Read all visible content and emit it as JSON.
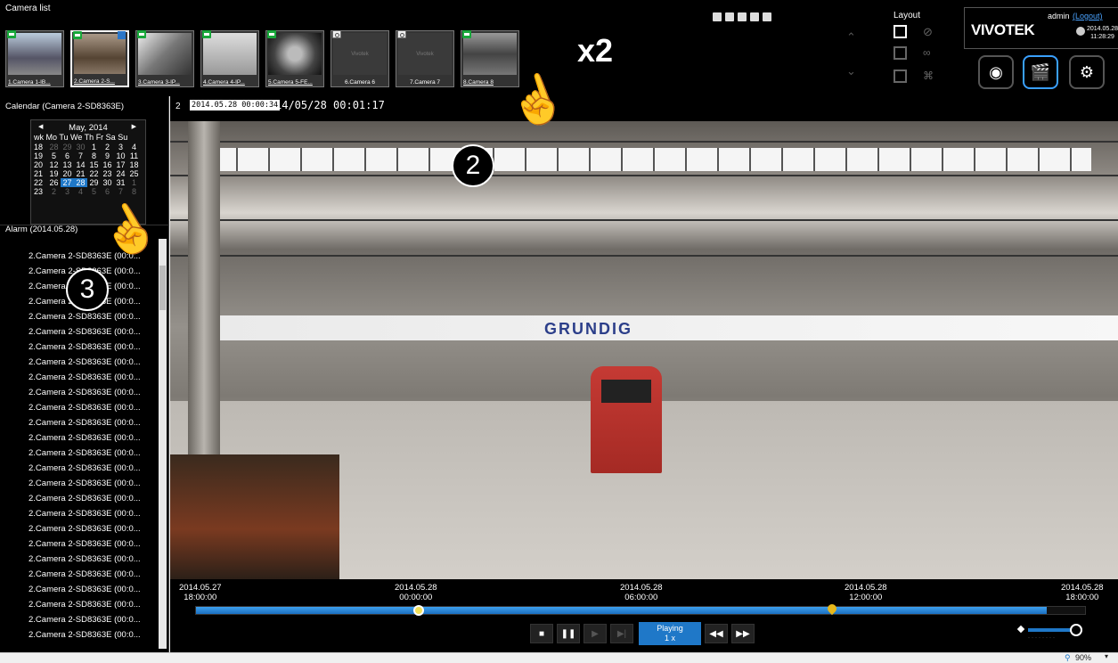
{
  "camera_list": {
    "title": "Camera list",
    "cameras": [
      {
        "label": "1.Camera 1-IB...",
        "status": "recording",
        "has_signal": true,
        "ptz": false,
        "selected": false
      },
      {
        "label": "2.Camera 2-S...",
        "status": "recording",
        "has_signal": true,
        "ptz": true,
        "selected": true
      },
      {
        "label": "3.Camera 3-IP...",
        "status": "recording",
        "has_signal": true,
        "ptz": false,
        "selected": false
      },
      {
        "label": "4.Camera 4-IP...",
        "status": "recording",
        "has_signal": true,
        "ptz": false,
        "selected": false
      },
      {
        "label": "5.Camera 5-FE...",
        "status": "recording",
        "has_signal": true,
        "ptz": false,
        "selected": false
      },
      {
        "label": "6.Camera 6",
        "status": "offline",
        "has_signal": false,
        "ptz": false,
        "selected": false
      },
      {
        "label": "7.Camera 7",
        "status": "offline",
        "has_signal": false,
        "ptz": false,
        "selected": false
      },
      {
        "label": "8.Camera 8",
        "status": "recording",
        "has_signal": true,
        "ptz": false,
        "selected": false
      }
    ],
    "no_signal_text": "Vivotek"
  },
  "overlay": {
    "double_click": "x2",
    "step_video": "2",
    "step_alarm": "3"
  },
  "layout": {
    "title": "Layout"
  },
  "brand": {
    "logo": "VIVOTEK",
    "user": "admin",
    "logout": "(Logout)",
    "date": "2014.05.28",
    "time": "11:28:29"
  },
  "calendar": {
    "title": "Calendar (Camera 2-SD8363E)",
    "month": "May, 2014",
    "header": "wk Mo Tu We Th Fr  Sa Su",
    "weeks": [
      {
        "wk": "18",
        "days": [
          "28",
          "29",
          "30",
          "1",
          "2",
          "3",
          "4"
        ],
        "dim": [
          0,
          1,
          2
        ]
      },
      {
        "wk": "19",
        "days": [
          "5",
          "6",
          "7",
          "8",
          "9",
          "10",
          "11"
        ],
        "dim": []
      },
      {
        "wk": "20",
        "days": [
          "12",
          "13",
          "14",
          "15",
          "16",
          "17",
          "18"
        ],
        "dim": []
      },
      {
        "wk": "21",
        "days": [
          "19",
          "20",
          "21",
          "22",
          "23",
          "24",
          "25"
        ],
        "dim": []
      },
      {
        "wk": "22",
        "days": [
          "26",
          "27",
          "28",
          "29",
          "30",
          "31",
          "1"
        ],
        "dim": [
          6
        ],
        "selected": [
          1,
          2
        ]
      },
      {
        "wk": "23",
        "days": [
          "2",
          "3",
          "4",
          "5",
          "6",
          "7",
          "8"
        ],
        "dim": [
          0,
          1,
          2,
          3,
          4,
          5,
          6
        ]
      }
    ]
  },
  "alarm": {
    "title": "Alarm (2014.05.28)",
    "items": [
      "2.Camera 2-SD8363E (00:0...",
      "2.Camera 2-SD8363E (00:0...",
      "2.Camera 2-SD8363E (00:0...",
      "2.Camera 2-SD8363E (00:0...",
      "2.Camera 2-SD8363E (00:0...",
      "2.Camera 2-SD8363E (00:0...",
      "2.Camera 2-SD8363E (00:0...",
      "2.Camera 2-SD8363E (00:0...",
      "2.Camera 2-SD8363E (00:0...",
      "2.Camera 2-SD8363E (00:0...",
      "2.Camera 2-SD8363E (00:0...",
      "2.Camera 2-SD8363E (00:0...",
      "2.Camera 2-SD8363E (00:0...",
      "2.Camera 2-SD8363E (00:0...",
      "2.Camera 2-SD8363E (00:0...",
      "2.Camera 2-SD8363E (00:0...",
      "2.Camera 2-SD8363E (00:0...",
      "2.Camera 2-SD8363E (00:0...",
      "2.Camera 2-SD8363E (00:0...",
      "2.Camera 2-SD8363E (00:0...",
      "2.Camera 2-SD8363E (00:0...",
      "2.Camera 2-SD8363E (00:0...",
      "2.Camera 2-SD8363E (00:0...",
      "2.Camera 2-SD8363E (00:0...",
      "2.Camera 2-SD8363E (00:0...",
      "2.Camera 2-SD8363E (00:0..."
    ]
  },
  "video": {
    "channel": "2",
    "start_stamp": "2014.05.28 00:00:34",
    "osd_time": "14/05/28 00:01:17",
    "sign_text": "GRUNDIG"
  },
  "timeline": {
    "ticks": [
      {
        "date": "2014.05.27",
        "time": "18:00:00"
      },
      {
        "date": "2014.05.28",
        "time": "00:00:00"
      },
      {
        "date": "2014.05.28",
        "time": "06:00:00"
      },
      {
        "date": "2014.05.28",
        "time": "12:00:00"
      },
      {
        "date": "2014.05.28",
        "time": "18:00:00"
      }
    ],
    "recorded_fraction": 0.955,
    "playhead_fraction": 0.25,
    "event_marker_fraction": 0.714,
    "playing_label": "Playing",
    "speed": "1 x"
  },
  "status_bar": {
    "zoom": "90%"
  },
  "colors": {
    "accent": "#1f78c8",
    "recording": "#19a83b",
    "background": "#000000"
  }
}
